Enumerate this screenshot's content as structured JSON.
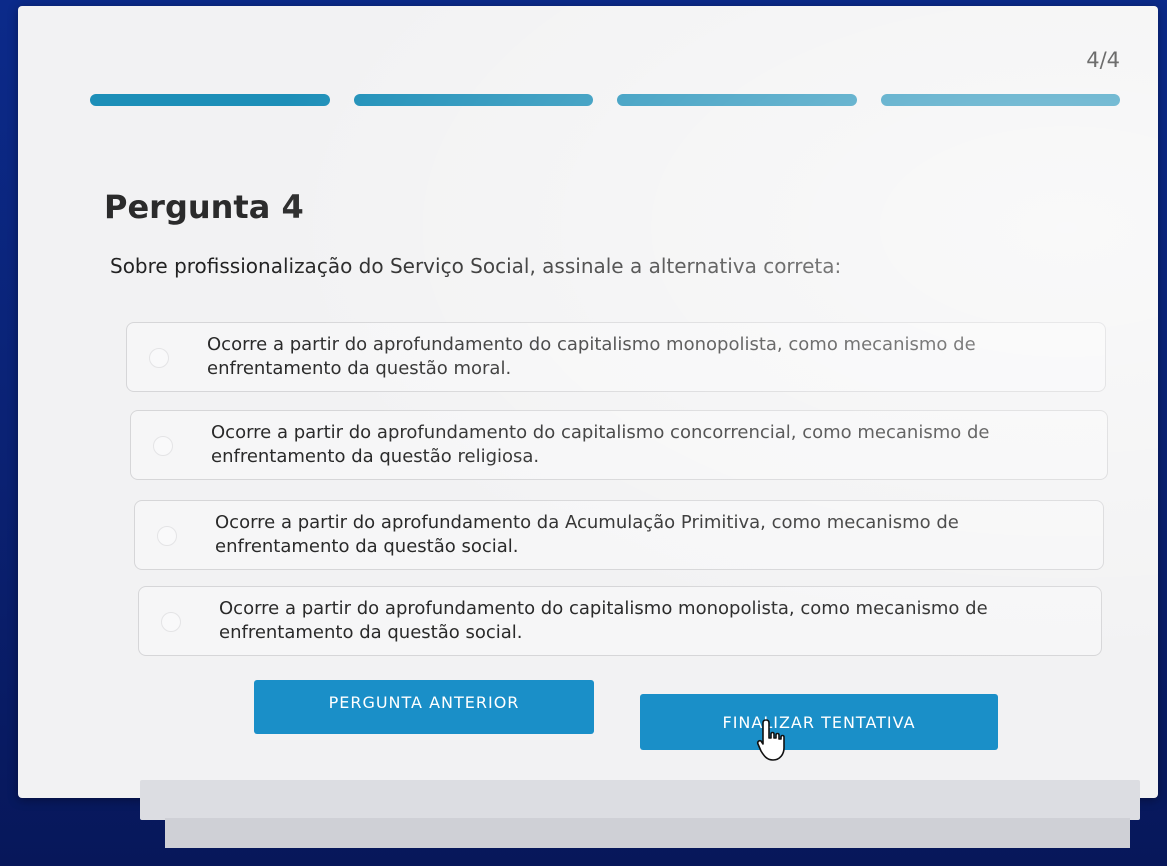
{
  "header": {
    "counter": "4/4",
    "progress": {
      "total_segments": 4,
      "completed_segments": 4,
      "color": "#1d8fb8"
    }
  },
  "question": {
    "title": "Pergunta 4",
    "text": "Sobre profissionalização do Serviço Social, assinale a alternativa correta:"
  },
  "options": [
    {
      "text": "Ocorre a partir do aprofundamento do capitalismo monopolista, como mecanismo de enfrentamento da questão moral."
    },
    {
      "text": "Ocorre a partir do aprofundamento do capitalismo concorrencial, como mecanismo de enfrentamento da questão religiosa."
    },
    {
      "text": "Ocorre a partir do aprofundamento da Acumulação Primitiva, como mecanismo de enfrentamento da questão social."
    },
    {
      "text": "Ocorre a partir do aprofundamento do capitalismo monopolista, como mecanismo de enfrentamento da questão social."
    }
  ],
  "actions": {
    "previous_label": "PERGUNTA ANTERIOR",
    "finish_label": "FINALIZAR TENTATIVA",
    "button_color": "#1a8fc8"
  },
  "icons": {
    "cursor": "hand-pointer-icon"
  }
}
